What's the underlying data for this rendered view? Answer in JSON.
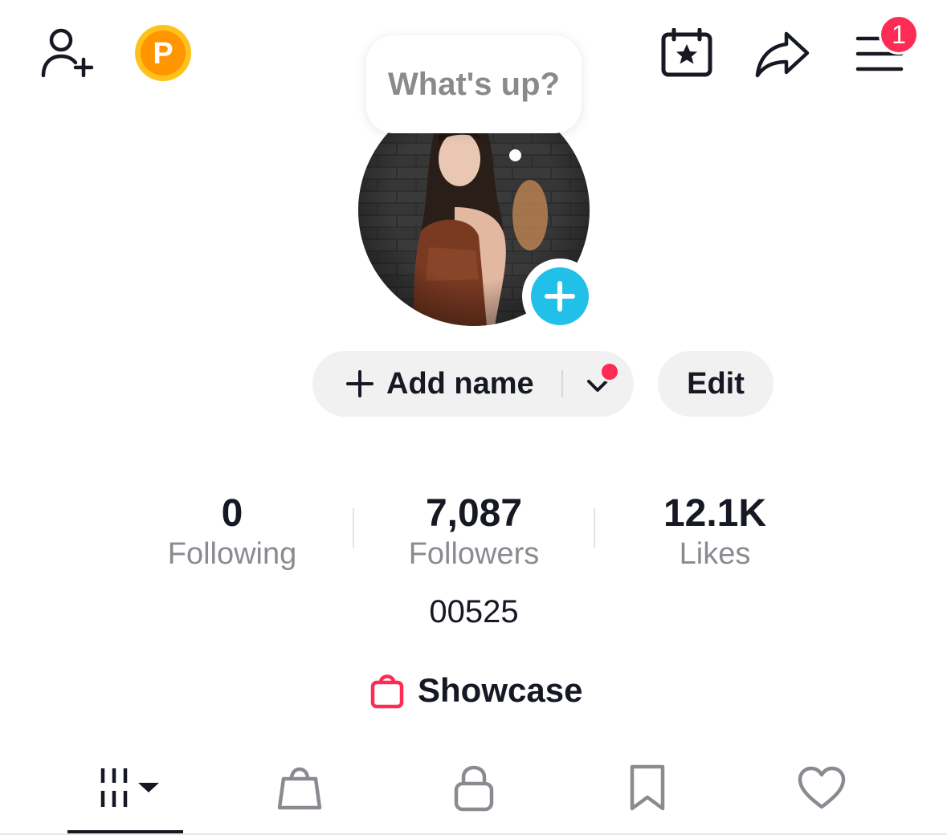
{
  "header": {
    "add_friend_icon": "person-plus-icon",
    "coin_letter": "P",
    "calendar_icon": "calendar-star-icon",
    "share_icon": "share-arrow-icon",
    "menu_icon": "hamburger-menu-icon",
    "menu_badge": "1"
  },
  "profile": {
    "status_bubble": "What's up?",
    "add_name_label": "Add name",
    "edit_label": "Edit",
    "bio": "00525",
    "showcase_label": "Showcase"
  },
  "stats": [
    {
      "value": "0",
      "label": "Following"
    },
    {
      "value": "7,087",
      "label": "Followers"
    },
    {
      "value": "12.1K",
      "label": "Likes"
    }
  ],
  "tabs": [
    {
      "icon": "grid-videos-icon",
      "active": true
    },
    {
      "icon": "shopping-bag-icon",
      "active": false
    },
    {
      "icon": "lock-icon",
      "active": false
    },
    {
      "icon": "bookmark-icon",
      "active": false
    },
    {
      "icon": "heart-icon",
      "active": false
    }
  ],
  "colors": {
    "accent_red": "#fe2c55",
    "avatar_add_blue": "#20c0e8",
    "coin_orange": "#ffa800",
    "pill_bg": "#f1f1f2",
    "muted_text": "#8a8b91"
  }
}
